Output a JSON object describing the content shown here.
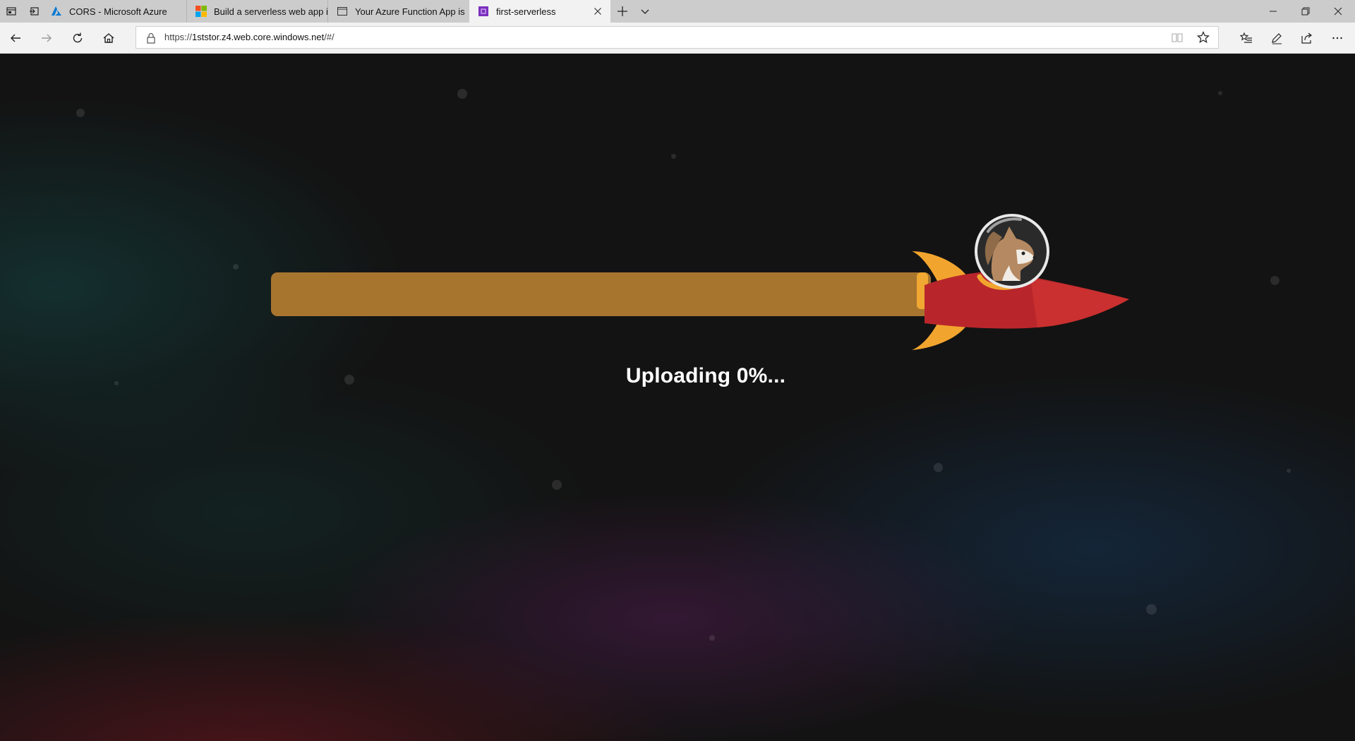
{
  "browser": {
    "tabs": [
      {
        "title": "CORS - Microsoft Azure",
        "icon": "azure-logo-icon",
        "active": false
      },
      {
        "title": "Build a serverless web app i",
        "icon": "microsoft-logo-icon",
        "active": false
      },
      {
        "title": "Your Azure Function App is",
        "icon": "page-icon",
        "active": false
      },
      {
        "title": "first-serverless",
        "icon": "purple-app-icon",
        "active": true
      }
    ],
    "url": {
      "scheme": "https://",
      "host": "1ststor.z4.web.core.windows.net",
      "path": "/#/"
    }
  },
  "page": {
    "status_text": "Uploading 0%...",
    "upload_progress_percent": 0,
    "colors": {
      "progress_track": "#a8752f",
      "progress_cap": "#f0a832",
      "rocket_body": "#c0262e",
      "rocket_fins": "#f2a52e"
    }
  }
}
